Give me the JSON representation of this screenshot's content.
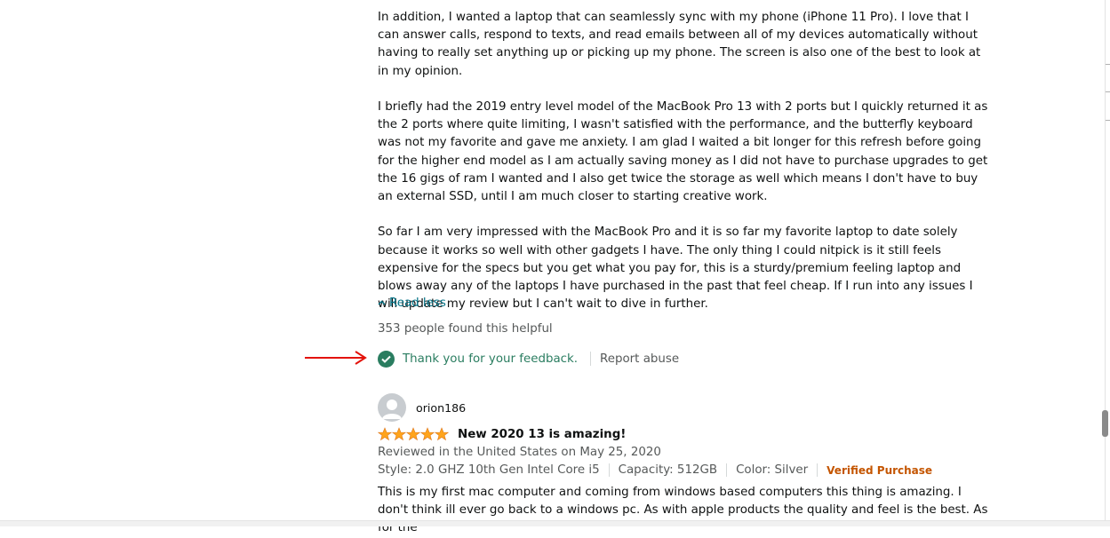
{
  "first_review": {
    "paragraphs": [
      "In addition, I wanted a laptop that can seamlessly sync with my phone (iPhone 11 Pro). I love that I can answer calls, respond to texts, and read emails between all of my devices automatically without having to really set anything up or picking up my phone. The screen is also one of the best to look at in my opinion.",
      "I briefly had the 2019 entry level model of the MacBook Pro 13 with 2 ports but I quickly returned it as the 2 ports where quite limiting, I wasn't satisfied with the performance, and the butterfly keyboard was not my favorite and gave me anxiety. I am glad I waited a bit longer for this refresh before going for the higher end model as I am actually saving money as I did not have to purchase upgrades to get the 16 gigs of ram I wanted and I also get twice the storage as well which means I don't have to buy an external SSD, until I am much closer to starting creative work.",
      "So far I am very impressed with the MacBook Pro and it is so far my favorite laptop to date solely because it works so well with other gadgets I have. The only thing I could nitpick is it still feels expensive for the specs but you get what you pay for, this is a sturdy/premium feeling laptop and blows away any of the laptops I have purchased in the past that feel cheap. If I run into any issues I will update my review but I can't wait to dive in further."
    ],
    "read_less_label": "Read less",
    "helpful_count_text": "353 people found this helpful",
    "feedback_text": "Thank you for your feedback.",
    "report_abuse_label": "Report abuse"
  },
  "second_review": {
    "reviewer_name": "orion186",
    "rating": 5,
    "rating_max": 5,
    "title": "New 2020 13 is amazing!",
    "date_text": "Reviewed in the United States on May 25, 2020",
    "style": "Style: 2.0 GHZ 10th Gen Intel Core i5",
    "capacity": "Capacity: 512GB",
    "color": "Color: Silver",
    "verified_label": "Verified Purchase",
    "body_text": "This is my first mac computer and coming from windows based computers this thing is amazing. I don't think ill ever go back to a windows pc. As with apple products the quality and feel is the best. As for the"
  },
  "colors": {
    "link": "#007185",
    "success": "#2a7d60",
    "star": "#ffa41c",
    "verified": "#c45500",
    "annotation_arrow": "#e3130b"
  }
}
